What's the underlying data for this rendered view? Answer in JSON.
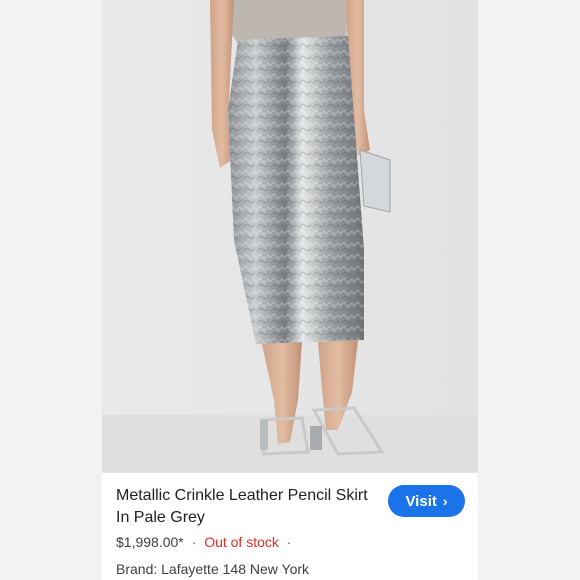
{
  "product": {
    "title": "Metallic Crinkle Leather Pencil Skirt In Pale Grey",
    "price": "$1,998.00*",
    "separator": "·",
    "stock_status": "Out of stock",
    "trailing_separator": "·",
    "brand_line": "Brand: Lafayette 148 New York"
  },
  "actions": {
    "visit_label": "Visit",
    "visit_icon": "chevron-right-icon"
  },
  "colors": {
    "visit_button": "#1a73e8",
    "out_of_stock": "#d93025",
    "skirt_silver": "#a9adb1"
  }
}
